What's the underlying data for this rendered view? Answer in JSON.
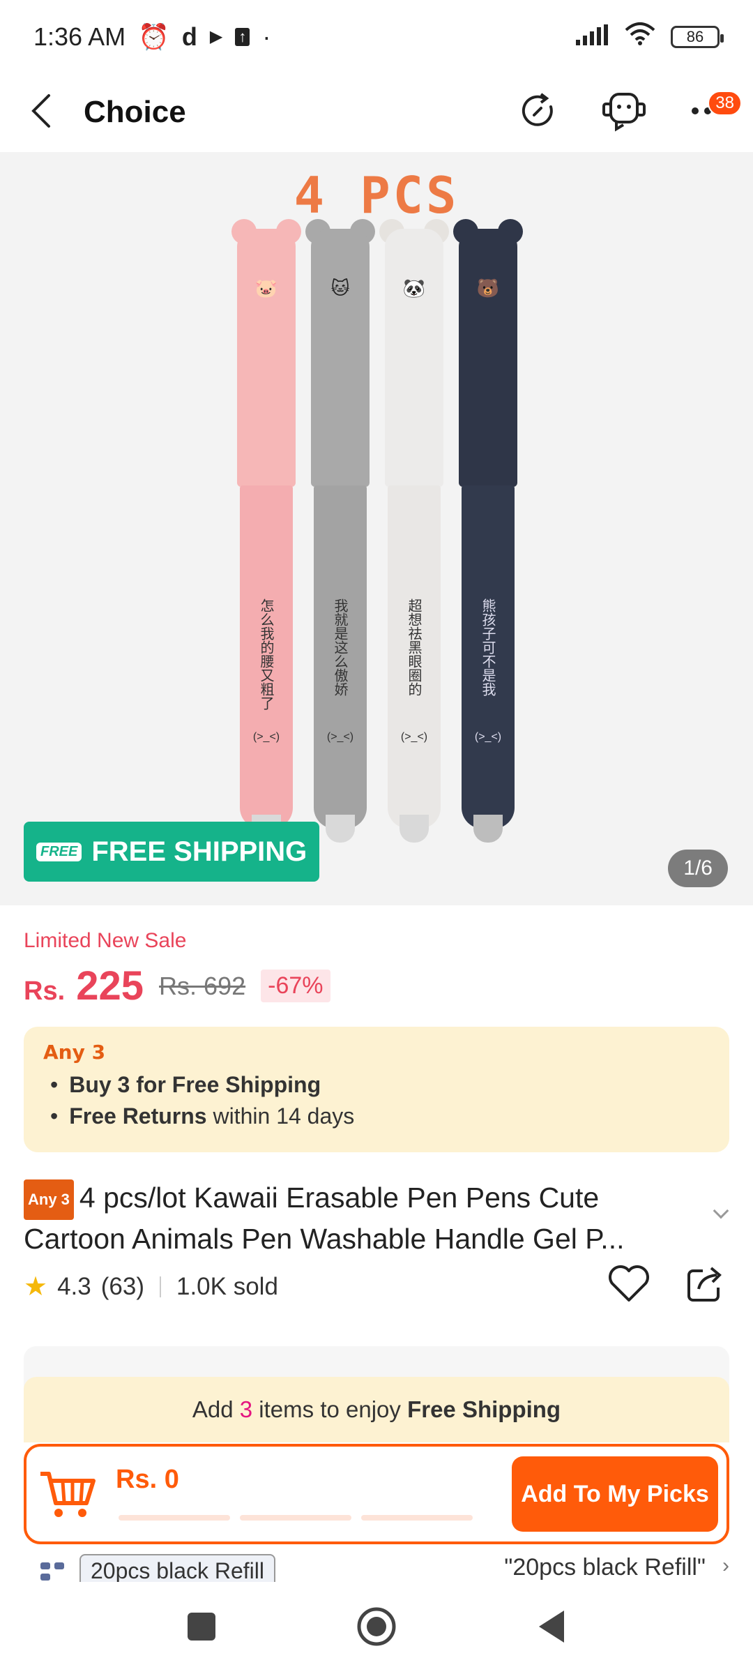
{
  "status_bar": {
    "time": "1:36 AM",
    "battery": "86"
  },
  "header": {
    "title": "Choice",
    "cart_badge": "38"
  },
  "hero": {
    "headline": "4 PCS",
    "pens": [
      {
        "color": "#f6b7b7",
        "text": "怎么我的腰又粗了"
      },
      {
        "color": "#a9a9a9",
        "text": "我就是这么傲娇"
      },
      {
        "color": "#ecebea",
        "text": "超想祛黑眼圈的"
      },
      {
        "color": "#2f3648",
        "text": "熊孩子可不是我"
      }
    ],
    "pen_face_text": "(>_<)",
    "free_shipping_badge": "FREE SHIPPING",
    "free_icon_text": "FREE",
    "image_counter": "1/6"
  },
  "price": {
    "label": "Limited New Sale",
    "currency": "Rs.",
    "current": "225",
    "original": "Rs. 692",
    "discount": "-67%"
  },
  "promo": {
    "tag": "Any 3",
    "line1_bold": "Buy 3 for  Free Shipping",
    "line2_bold": "Free Returns",
    "line2_rest": " within 14 days"
  },
  "product": {
    "badge": "Any 3",
    "title": "4 pcs/lot Kawaii Erasable Pen Pens Cute Cartoon Animals Pen Washable Handle Gel P...",
    "rating": "4.3",
    "reviews": "(63)",
    "sold": "1.0K sold"
  },
  "shipping_note": {
    "pre": "Add ",
    "count": "3",
    "mid": " items to enjoy ",
    "bold": "Free Shipping"
  },
  "cart": {
    "price": "Rs. 0",
    "button": "Add To My Picks"
  },
  "variant": {
    "chip": "20pcs black Refill",
    "value": "\"20pcs black Refill\""
  },
  "colors": {
    "accent": "#ff5b0a",
    "sale": "#e9445a",
    "free_ship": "#15b38a"
  }
}
